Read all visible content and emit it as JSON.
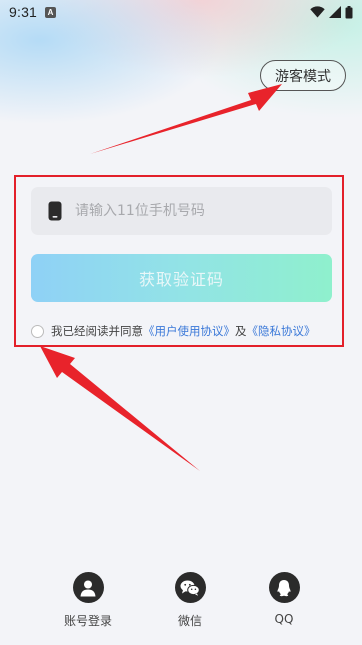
{
  "status_bar": {
    "time": "9:31",
    "notification_letter": "A",
    "icons": [
      "wifi-icon",
      "signal-icon",
      "battery-icon"
    ]
  },
  "header": {
    "guest_mode_label": "游客模式"
  },
  "login": {
    "phone_placeholder": "请输入11位手机号码",
    "phone_value": "",
    "get_code_label": "获取验证码",
    "agreement": {
      "checked": false,
      "prefix": "我已经阅读并同意",
      "user_agreement": "《用户使用协议》",
      "and": "及",
      "privacy_agreement": "《隐私协议》"
    }
  },
  "social_login": {
    "account": {
      "label": "账号登录",
      "icon": "user-icon"
    },
    "wechat": {
      "label": "微信",
      "icon": "wechat-icon"
    },
    "qq": {
      "label": "QQ",
      "icon": "qq-icon"
    }
  },
  "colors": {
    "annotation_red": "#e3202a",
    "link_blue": "#3a78d8",
    "button_gradient_start": "#8fd1f6",
    "button_gradient_end": "#8ff0cd",
    "social_icon_bg": "#2b2b2b"
  }
}
